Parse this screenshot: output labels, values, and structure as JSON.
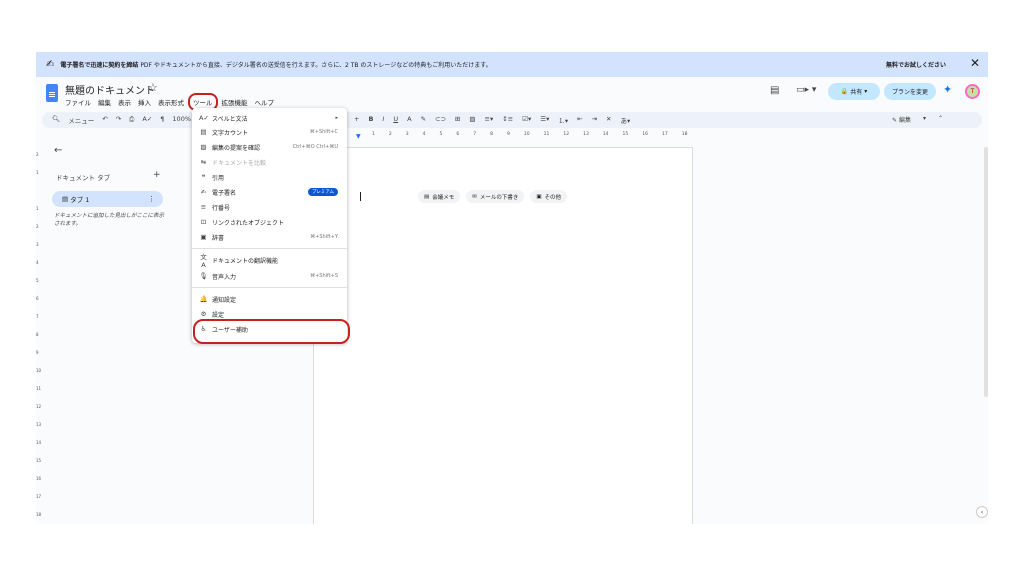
{
  "banner": {
    "message_bold": "電子署名で迅速に契約を締結",
    "message_rest": " PDF やドキュメントから直接、デジタル署名の送受信を行えます。さらに、2 TB のストレージなどの特典もご利用いただけます。",
    "try_label": "無料でお試しください",
    "close": "✕"
  },
  "doc": {
    "title": "無題のドキュメント",
    "star": "☆"
  },
  "menubar": [
    "ファイル",
    "編集",
    "表示",
    "挿入",
    "表示形式",
    "ツール",
    "拡張機能",
    "ヘルプ"
  ],
  "header": {
    "share_label": "共有",
    "plan_label": "プランを変更",
    "avatar": "T"
  },
  "toolbar": {
    "menu_search": "メニュー",
    "zoom": "100%",
    "edit_mode": "編集"
  },
  "ruler_ticks": [
    "1",
    "2",
    "3",
    "4",
    "5",
    "6",
    "7",
    "8",
    "9",
    "10",
    "11",
    "12",
    "13",
    "14",
    "15",
    "16",
    "17",
    "18"
  ],
  "vruler_ticks": [
    "2",
    "1",
    "1",
    "2",
    "3",
    "4",
    "5",
    "6",
    "7",
    "8",
    "9",
    "10",
    "11",
    "12",
    "13",
    "14",
    "15",
    "16",
    "17",
    "18"
  ],
  "sidebar": {
    "tabs_label": "ドキュメント タブ",
    "tab1": "タブ 1",
    "note": "ドキュメントに追加した見出しがここに表示されます。"
  },
  "chips": [
    "会議メモ",
    "メールの下書き",
    "その他"
  ],
  "tools_menu": {
    "items": [
      {
        "label": "スペルと文法",
        "icon": "A✓",
        "shortcut": "",
        "arrow": true
      },
      {
        "label": "文字カウント",
        "icon": "▤",
        "shortcut": "⌘+Shift+C"
      },
      {
        "label": "編集の提案を確認",
        "icon": "▨",
        "shortcut": "Ctrl+⌘O Ctrl+⌘U"
      },
      {
        "label": "ドキュメントを比較",
        "icon": "⇆",
        "shortcut": "",
        "disabled": true
      },
      {
        "label": "引用",
        "icon": "❝",
        "shortcut": ""
      },
      {
        "label": "電子署名",
        "icon": "✍",
        "badge": "プレミアム"
      },
      {
        "label": "行番号",
        "icon": "≡",
        "shortcut": ""
      },
      {
        "label": "リンクされたオブジェクト",
        "icon": "⊡",
        "shortcut": ""
      },
      {
        "label": "辞書",
        "icon": "▣",
        "shortcut": "⌘+Shift+Y"
      },
      {
        "label": "ドキュメントの翻訳機能",
        "icon": "文A",
        "shortcut": ""
      },
      {
        "label": "音声入力",
        "icon": "🎙",
        "shortcut": "⌘+Shift+S"
      },
      {
        "label": "通知設定",
        "icon": "🔔",
        "shortcut": ""
      },
      {
        "label": "設定",
        "icon": "⚙",
        "shortcut": ""
      },
      {
        "label": "ユーザー補助",
        "icon": "♿",
        "shortcut": ""
      }
    ]
  }
}
